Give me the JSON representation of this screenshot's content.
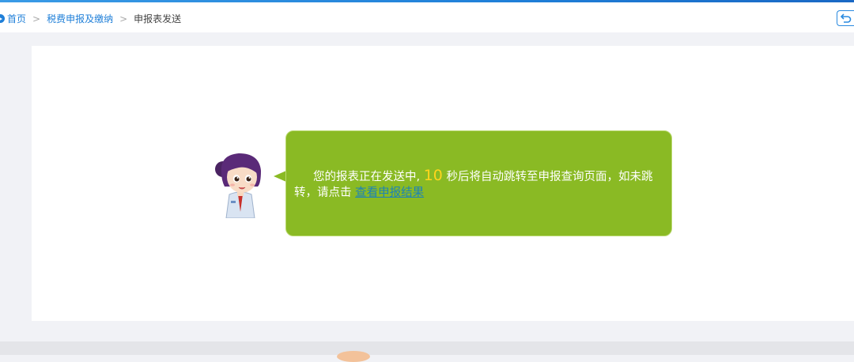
{
  "breadcrumb": {
    "home_label": "首页",
    "separator": ">",
    "section_label": "税费申报及缴纳",
    "current_label": "申报表发送"
  },
  "message": {
    "before_count": "您的报表正在发送中,",
    "countdown": "10",
    "after_count": "秒后将自动跳转至申报查询页面，如未跳转，请点击",
    "link_label": "查看申报结果"
  },
  "colors": {
    "accent": "#1f7fd8",
    "bubble": "#8aba24",
    "countdown": "#ffd51c",
    "link": "#1c82b8"
  },
  "icons": {
    "home": "home-icon",
    "back": "back-arrow-icon",
    "mascot": "tax-officer-avatar"
  }
}
